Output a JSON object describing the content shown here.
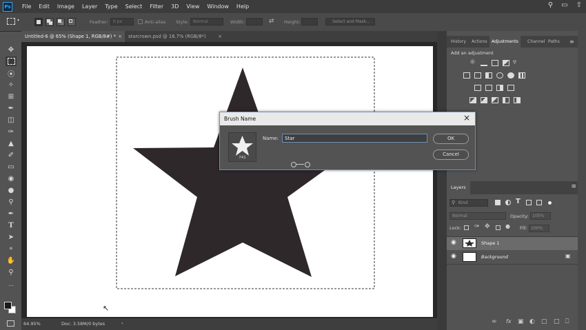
{
  "app": {
    "logo": "Ps"
  },
  "menu": [
    "File",
    "Edit",
    "Image",
    "Layer",
    "Type",
    "Select",
    "Filter",
    "3D",
    "View",
    "Window",
    "Help"
  ],
  "menu_right_icons": [
    "search-icon",
    "workspace-icon",
    "share-icon"
  ],
  "options": {
    "feather_label": "Feather:",
    "feather_value": "0 px",
    "antialias_label": "Anti-alias",
    "style_label": "Style:",
    "style_value": "Normal",
    "width_label": "Width:",
    "height_label": "Height:",
    "select_mask": "Select and Mask..."
  },
  "tabs": [
    {
      "label": "Untitled-6 @ 65% (Shape 1, RGB/8#) *",
      "active": true
    },
    {
      "label": "starcrown.psd @ 16.7% (RGB/8*)",
      "active": false
    }
  ],
  "status": {
    "zoom": "64.95%",
    "doc": "Doc: 3.58M/0 bytes"
  },
  "panels": {
    "tabs": [
      "History",
      "Actions",
      "Adjustments",
      "Channel",
      "Paths"
    ],
    "active_tab": "Adjustments",
    "add_adjustment": "Add an adjustment"
  },
  "layers": {
    "title": "Layers",
    "kind_label": "Kind",
    "blend_mode": "Normal",
    "opacity_label": "Opacity:",
    "opacity_value": "100%",
    "lock_label": "Lock:",
    "fill_label": "Fill:",
    "fill_value": "100%",
    "items": [
      {
        "name": "Shape 1",
        "selected": true,
        "italic": false
      },
      {
        "name": "Background",
        "selected": false,
        "italic": true
      }
    ]
  },
  "dialog": {
    "title": "Brush Name",
    "name_label": "Name:",
    "name_value": "Star",
    "brush_size": "741",
    "ok": "OK",
    "cancel": "Cancel"
  },
  "colors": {
    "star": "#2e282b",
    "accent": "#6e8fb3"
  }
}
